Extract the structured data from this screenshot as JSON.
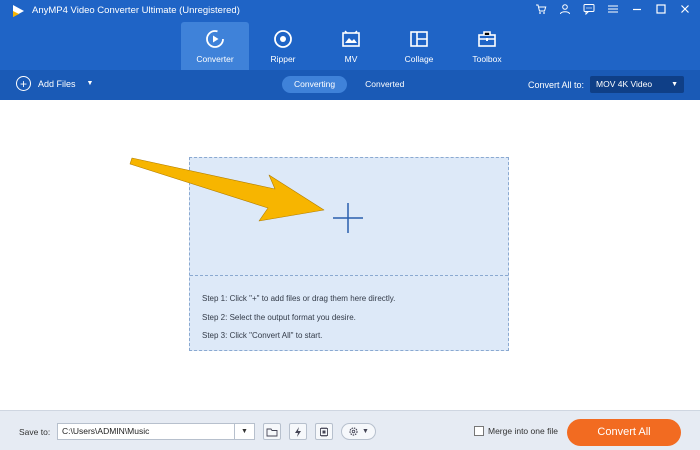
{
  "app": {
    "title": "AnyMP4 Video Converter Ultimate (Unregistered)"
  },
  "window_controls": [
    "cart-icon",
    "account-icon",
    "feedback-icon",
    "menu-icon",
    "minimize-icon",
    "maximize-icon",
    "close-icon"
  ],
  "main_tabs": [
    {
      "label": "Converter",
      "icon": "converter-icon",
      "active": true
    },
    {
      "label": "Ripper",
      "icon": "ripper-icon",
      "active": false
    },
    {
      "label": "MV",
      "icon": "mv-icon",
      "active": false
    },
    {
      "label": "Collage",
      "icon": "collage-icon",
      "active": false
    },
    {
      "label": "Toolbox",
      "icon": "toolbox-icon",
      "active": false
    }
  ],
  "toolbar": {
    "add_files": "Add Files",
    "segments": [
      {
        "label": "Converting",
        "active": true
      },
      {
        "label": "Converted",
        "active": false
      }
    ],
    "convert_all_to_label": "Convert All to:",
    "format": "MOV 4K Video"
  },
  "dropzone": {
    "steps": [
      "Step 1: Click \"+\" to add files or drag them here directly.",
      "Step 2: Select the output format you desire.",
      "Step 3: Click \"Convert All\" to start."
    ]
  },
  "bottom": {
    "save_to_label": "Save to:",
    "save_path": "C:\\Users\\ADMIN\\Music",
    "merge_label": "Merge into one file",
    "merge_checked": false,
    "convert_all": "Convert All"
  },
  "colors": {
    "titlebar": "#1f64c6",
    "active_tab": "#3f82d9",
    "subbar": "#1a5ab6",
    "dropzone_bg": "#dde9f8",
    "arrow": "#f7b500",
    "convert_button": "#f26b21"
  }
}
